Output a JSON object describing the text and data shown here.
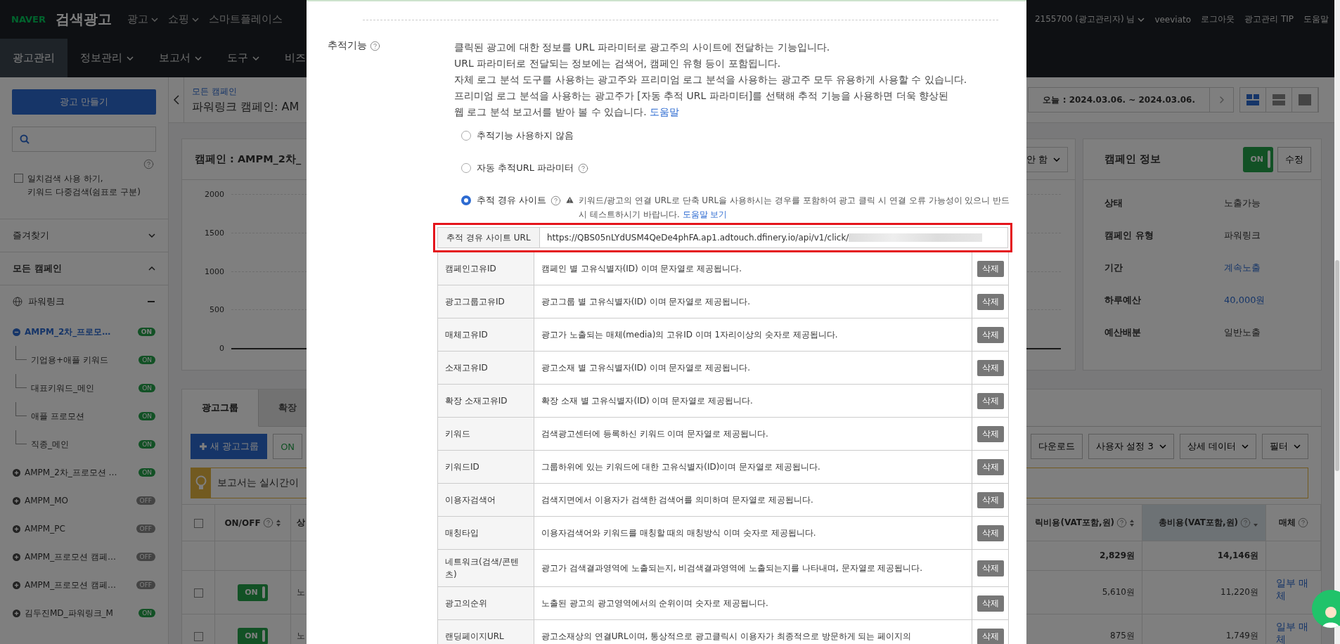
{
  "header": {
    "logo": "NAVER",
    "product": "검색광고",
    "nav": [
      {
        "label": "광고",
        "dropdown": true
      },
      {
        "label": "쇼핑",
        "dropdown": true
      },
      {
        "label": "스마트플레이스",
        "dropdown": false
      }
    ],
    "account": "2155700 (광고관리자) 님",
    "user": "veeviato",
    "logout": "로그아웃",
    "links": [
      "광고관리 TIP",
      "도움말"
    ]
  },
  "main_nav": [
    {
      "label": "광고관리",
      "selected": true,
      "dropdown": false
    },
    {
      "label": "정보관리",
      "selected": false,
      "dropdown": true
    },
    {
      "label": "보고서",
      "selected": false,
      "dropdown": true
    },
    {
      "label": "도구",
      "selected": false,
      "dropdown": true
    },
    {
      "label": "비즈",
      "selected": false,
      "dropdown": false
    }
  ],
  "sidebar": {
    "create_button": "광고 만들기",
    "exact_match": {
      "checked": false,
      "label": "일치검색 사용 하기,\n키워드 다중검색(쉼표로 구분)"
    },
    "favorites": {
      "label": "즐겨찾기",
      "expanded": false
    },
    "all_campaigns": {
      "label": "모든 캠페인",
      "expanded": true
    },
    "group": {
      "label": "파워링크",
      "expanded": true
    },
    "campaigns": [
      {
        "name": "AMPM_2차_프로모…",
        "toggle": "ON",
        "on": true,
        "expanded": true,
        "selected": true,
        "children": [
          {
            "name": "기업용+애플 키워드",
            "toggle": "ON",
            "on": true
          },
          {
            "name": "대표키워드_메인",
            "toggle": "ON",
            "on": true
          },
          {
            "name": "애플 프로모션",
            "toggle": "ON",
            "on": true
          },
          {
            "name": "직종_메인",
            "toggle": "ON",
            "on": true
          }
        ]
      },
      {
        "name": "AMPM_2차_프로모션 …",
        "toggle": "ON",
        "on": true,
        "expanded": false,
        "selected": false
      },
      {
        "name": "AMPM_MO",
        "toggle": "OFF",
        "on": false,
        "expanded": false,
        "selected": false
      },
      {
        "name": "AMPM_PC",
        "toggle": "OFF",
        "on": false,
        "expanded": false,
        "selected": false
      },
      {
        "name": "AMPM_프로모션 캠페…",
        "toggle": "OFF",
        "on": false,
        "expanded": false,
        "selected": false
      },
      {
        "name": "AMPM_프로모션 캠페…",
        "toggle": "OFF",
        "on": false,
        "expanded": false,
        "selected": false
      },
      {
        "name": "김두진MD_파워링크_M",
        "toggle": "ON",
        "on": true,
        "expanded": false,
        "selected": false
      }
    ]
  },
  "page": {
    "breadcrumb": "모든 캠페인",
    "title": "파워링크 캠페인: AM",
    "date_range": "오늘 : 2024.03.06. ~ 2024.03.06.",
    "views": [
      {
        "selected": true
      },
      {
        "selected": false
      },
      {
        "selected": false
      }
    ]
  },
  "chart_card": {
    "title": "캠페인 : AMPM_2차_",
    "compare_select": "안 함",
    "y_ticks": [
      "2000",
      "1500",
      "1000",
      "500",
      "0"
    ]
  },
  "campaign_info": {
    "title": "캠페인 정보",
    "toggle": "ON",
    "on": true,
    "edit_button": "수정",
    "rows": [
      {
        "label": "상태",
        "value": "노출가능",
        "link": false
      },
      {
        "label": "캠페인 유형",
        "value": "파워링크",
        "link": false
      },
      {
        "label": "기간",
        "value": "계속노출",
        "link": true
      },
      {
        "label": "하루예산",
        "value": "40,000원",
        "link": true
      },
      {
        "label": "예산배분",
        "value": "일반노출",
        "link": false
      }
    ]
  },
  "groups_panel": {
    "tabs": [
      {
        "label": "광고그룹",
        "selected": true
      },
      {
        "label": "확장",
        "selected": false
      }
    ],
    "new_button": "새 광고그룹",
    "on_button": "ON",
    "notice": "보고서는 실시간이",
    "tools": [
      "다운로드",
      "사용자 설정 3",
      "상세 데이터",
      "필터"
    ],
    "select_all": {
      "checked": false
    },
    "columns": [
      {
        "label": "ON/OFF",
        "help": true,
        "sortable": true,
        "sorted": false
      },
      {
        "label": "상"
      },
      {
        "label": "릭비용(VAT포함,원)",
        "help": true,
        "sortable": true,
        "sorted": false
      },
      {
        "label": "총비용(VAT포함,원)",
        "help": true,
        "sortable": true,
        "sorted": true
      },
      {
        "label": "매체",
        "help": true,
        "sortable": false,
        "sorted": false
      }
    ],
    "total_row": {
      "click_cost": "2,829원",
      "total_cost": "14,146원"
    },
    "rows": [
      {
        "checked": false,
        "toggle": "ON",
        "on": true,
        "status": "노",
        "click_cost": "5,610원",
        "total_cost": "11,220원",
        "media": "일부 매체"
      },
      {
        "checked": false,
        "toggle": "ON",
        "on": true,
        "status": "노",
        "click_cost": "875원",
        "total_cost": "1,749원",
        "media": "일부 매체"
      }
    ]
  },
  "modal": {
    "section_label": "추적기능",
    "description": [
      "클릭된 광고에 대한 정보를 URL 파라미터로 광고주의 사이트에 전달하는 기능입니다.",
      "URL 파라미터로 전달되는 정보에는 검색어, 캠페인 유형 등이 포함됩니다.",
      "자체 로그 분석 도구를 사용하는 광고주와 프리미엄 로그 분석을 사용하는 광고주 모두 유용하게 사용할 수 있습니다.",
      "프리미엄 로그 분석을 사용하는 광고주가 [자동 추적 URL 파라미터]를 선택해 추적 기능을 사용하면 더욱 향상된",
      "웹 로그 분석 보고서를 받아 볼 수 있습니다."
    ],
    "help_link": "도움말",
    "options": [
      {
        "label": "추적기능 사용하지 않음",
        "selected": false,
        "help": false
      },
      {
        "label": "자동 추적URL 파라미터",
        "selected": false,
        "help": true
      },
      {
        "label": "추적 경유 사이트",
        "selected": true,
        "help": true,
        "warning": "키워드/광고의 연결 URL로 단축 URL을 사용하시는 경우를 포함하여 광고 클릭 시 연결 오류 가능성이 있으니 반드시 테스트하시기 바랍니다.",
        "warning_link": "도움말 보기"
      }
    ],
    "url_field": {
      "label": "추적 경유 사이트 URL",
      "value": "https://QBS05nLYdUSM4QeDe4phFA.ap1.adtouch.dfinery.io/api/v1/click/",
      "highlighted": true
    },
    "parameters": [
      {
        "name": "캠페인고유ID",
        "description": "캠페인 별 고유식별자(ID) 이며 문자열로 제공됩니다.",
        "action": "삭제"
      },
      {
        "name": "광고그룹고유ID",
        "description": "광고그룹 별 고유식별자(ID) 이며 문자열로 제공됩니다.",
        "action": "삭제"
      },
      {
        "name": "매체고유ID",
        "description": "광고가 노출되는 매체(media)의 고유ID 이며 1자리이상의 숫자로 제공됩니다.",
        "action": "삭제"
      },
      {
        "name": "소재고유ID",
        "description": "광고소재 별 고유식별자(ID) 이며 문자열로 제공됩니다.",
        "action": "삭제"
      },
      {
        "name": "확장 소재고유ID",
        "description": "확장 소재 별 고유식별자(ID) 이며 문자열로 제공됩니다.",
        "action": "삭제"
      },
      {
        "name": "키워드",
        "description": "검색광고센터에 등록하신 키워드 이며 문자열로 제공됩니다.",
        "action": "삭제"
      },
      {
        "name": "키워드ID",
        "description": "그룹하위에 있는 키워드에 대한 고유식별자(ID)이며 문자열로 제공됩니다.",
        "action": "삭제"
      },
      {
        "name": "이용자검색어",
        "description": "검색지면에서 이용자가 검색한 검색어를 의미하며 문자열로 제공됩니다.",
        "action": "삭제"
      },
      {
        "name": "매칭타입",
        "description": "이용자검색어와 키워드를 매칭할 때의 매칭방식 이며 숫자로 제공됩니다.",
        "action": "삭제"
      },
      {
        "name": "네트워크(검색/콘텐츠)",
        "description": "광고가 검색결과영역에 노출되는지, 비검색결과영역에 노출되는지를 나타내며, 문자열로 제공됩니다.",
        "action": "삭제"
      },
      {
        "name": "광고의순위",
        "description": "노출된 광고의 광고영역에서의 순위이며 숫자로 제공됩니다.",
        "action": "삭제"
      },
      {
        "name": "랜딩페이지URL",
        "description": "광고소재상의 연결URL이며, 통상적으로 광고클릭시 이용자가 최종적으로 방문하게 되는 페이지의",
        "action": "삭제"
      }
    ]
  }
}
